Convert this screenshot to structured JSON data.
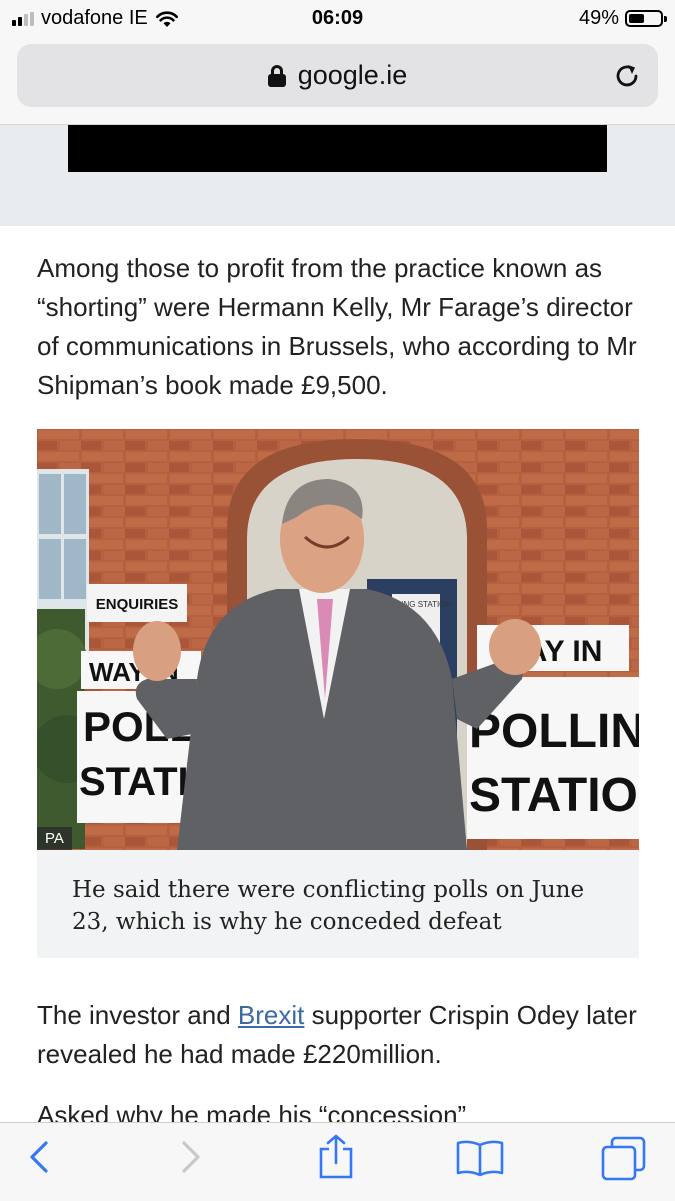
{
  "status_bar": {
    "carrier": "vodafone IE",
    "time": "06:09",
    "battery": "49%",
    "battery_level": 0.49,
    "signal_bars": 2
  },
  "url_bar": {
    "domain": "google.ie",
    "lock_icon": "lock-icon",
    "reload_icon": "reload-icon"
  },
  "article": {
    "paragraph1": "Among those to profit from the practice known as “shorting” were Hermann Kelly, Mr Farage’s director of communications in Brussels, who according to Mr Shipman’s book made £9,500.",
    "photo": {
      "credit": "PA",
      "sign_enquiries": "ENQUIRIES",
      "sign_way_in_left": "WAY IN",
      "sign_way_in_right": "WAY IN",
      "sign_polling_left": "POLLI",
      "sign_station_left": "STATION",
      "sign_polling_right": "POLLING",
      "sign_station_right": "STATION",
      "door_sign": "POLLING STATION"
    },
    "caption": "He said there were conflicting polls on June 23, which is why he conceded defeat",
    "paragraph2_before": "The investor and ",
    "paragraph2_link": "Brexit",
    "paragraph2_after": " supporter Crispin Odey later revealed he had made £220million.",
    "paragraph3_partial": "Asked why he made his “concession”"
  },
  "toolbar": {
    "back_icon": "chevron-left-icon",
    "forward_icon": "chevron-right-icon",
    "share_icon": "share-icon",
    "bookmarks_icon": "book-icon",
    "tabs_icon": "tabs-icon"
  },
  "colors": {
    "link": "#3b6aa5",
    "toolbar_tint": "#3478f6",
    "ad_band": "#e9ecee",
    "caption_bg": "#f2f3f4"
  }
}
